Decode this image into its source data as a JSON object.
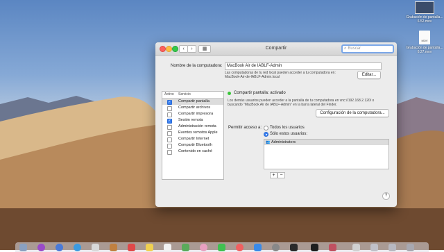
{
  "window": {
    "title": "Compartir",
    "search_placeholder": "Buscar",
    "computer_name_label": "Nombre de la computadora:",
    "computer_name_value": "MacBook Air de IABLF-Admin",
    "network_note_line1": "Las computadoras de tu red local pueden acceder a tu computadora en:",
    "network_note_line2": "MacBook-Air-de-IABLF-Admin.local",
    "edit_button": "Editar..."
  },
  "services": {
    "header_active": "Activo",
    "header_service": "Servicio",
    "items": [
      {
        "label": "Compartir pantalla",
        "checked": true,
        "selected": true
      },
      {
        "label": "Compartir archivos",
        "checked": false,
        "selected": false
      },
      {
        "label": "Compartir impresora",
        "checked": false,
        "selected": false
      },
      {
        "label": "Sesión remota",
        "checked": true,
        "selected": false
      },
      {
        "label": "Administración remota",
        "checked": false,
        "selected": false
      },
      {
        "label": "Eventos remotos Apple",
        "checked": false,
        "selected": false
      },
      {
        "label": "Compartir Internet",
        "checked": false,
        "selected": false
      },
      {
        "label": "Compartir Bluetooth",
        "checked": false,
        "selected": false
      },
      {
        "label": "Contenido en caché",
        "checked": false,
        "selected": false
      }
    ]
  },
  "detail": {
    "status": "Compartir pantalla: activado",
    "desc_line1": "Los demás usuarios pueden acceder a la pantalla de tu computadora en vnc://192.168.2.120/ o",
    "desc_line2": "buscando \"MacBook Air de IABLF-Admin\" en la barra lateral del Finder.",
    "config_button": "Configuración de la computadora...",
    "access_label": "Permitir acceso a:",
    "option_all": "Todos los usuarios",
    "option_only": "Sólo estos usuarios:",
    "selected_option": "only",
    "users": [
      "Administrators"
    ],
    "add_button": "+",
    "remove_button": "−",
    "help_button": "?"
  },
  "desktop": {
    "file1": "Grabación de pantalla... 6.52.mov",
    "file2_tag": "MOV",
    "file2": "Grabación de pantalla... 6.27.mov"
  },
  "colors": {
    "accent": "#3a80f0",
    "status_on": "#3ac63a"
  }
}
